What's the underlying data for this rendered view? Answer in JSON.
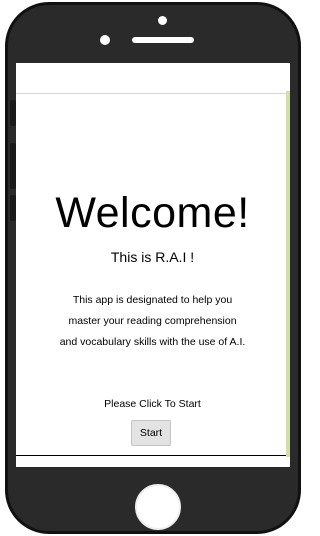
{
  "screen": {
    "title": "Welcome!",
    "subtitle": "This is R.A.I !",
    "description_lines": [
      "This app is designated to help you",
      "master your reading comprehension",
      "and vocabulary skills with the use of A.I."
    ],
    "prompt": "Please Click To Start",
    "start_label": "Start"
  },
  "colors": {
    "phone_body": "#2a2a2a",
    "accent_bar": "#cfe0a8",
    "button_bg": "#e3e3e3"
  }
}
